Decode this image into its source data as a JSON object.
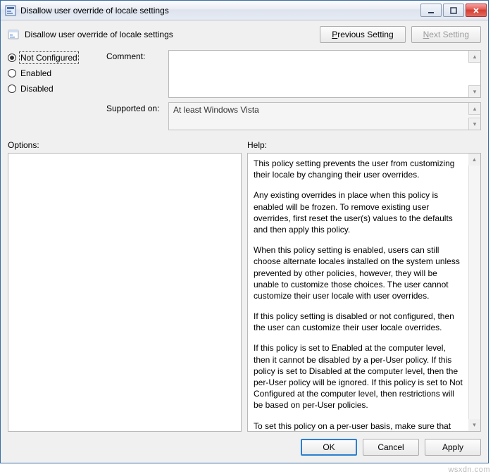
{
  "window": {
    "title": "Disallow user override of locale settings",
    "icon": "policy-icon",
    "buttons": {
      "minimize": "minimize-icon",
      "maximize": "maximize-icon",
      "close": "close-icon"
    }
  },
  "header": {
    "icon": "policy-setting-icon",
    "title": "Disallow user override of locale settings",
    "previous_label": "Previous Setting",
    "next_label": "Next Setting"
  },
  "radios": {
    "not_configured": "Not Configured",
    "enabled": "Enabled",
    "disabled": "Disabled",
    "selected": "not_configured"
  },
  "fields": {
    "comment_label": "Comment:",
    "comment_value": "",
    "supported_label": "Supported on:",
    "supported_value": "At least Windows Vista"
  },
  "sections": {
    "options_label": "Options:",
    "help_label": "Help:"
  },
  "help": {
    "p1": "This policy setting prevents the user from customizing their locale by changing their user overrides.",
    "p2": "Any existing overrides in place when this policy is enabled will be frozen. To remove existing user overrides, first reset the user(s) values to the defaults and then apply this policy.",
    "p3": "When this policy setting is enabled, users can still choose alternate locales installed on the system unless prevented by other policies, however, they will be unable to customize those choices.  The user cannot customize their user locale with user overrides.",
    "p4": "If this policy setting is disabled or not configured, then the user can customize their user locale overrides.",
    "p5": "If this policy is set to Enabled at the computer level, then it cannot be disabled by a per-User policy. If this policy is set to Disabled at the computer level, then the per-User policy will be ignored. If this policy is set to Not Configured at the computer level, then restrictions will be based on per-User policies.",
    "p6": "To set this policy on a per-user basis, make sure that the per-computer policy is set to Not Configured."
  },
  "footer": {
    "ok": "OK",
    "cancel": "Cancel",
    "apply": "Apply"
  },
  "watermark": "wsxdn.com"
}
